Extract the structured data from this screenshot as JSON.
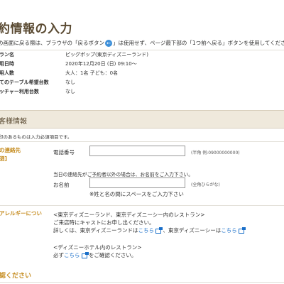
{
  "page": {
    "title": "約情報の入力",
    "back_note_before": "の画面に戻る際は、ブラウザの「戻るボタン",
    "back_icon": "←",
    "back_note_after": "」は使用せず、ページ最下部の「1つ前へ戻る」ボタンを使用してください。"
  },
  "summary": [
    {
      "label": "ラン名",
      "value": "ピッグポップ(東京ディズニーランド)"
    },
    {
      "label": "用日時",
      "value": "2020年12月20日 (日) 09:10～"
    },
    {
      "label": "用人数",
      "value": "大人：1名 子ども：0名"
    },
    {
      "label": "てのテーブル希望台数",
      "value": "なし"
    },
    {
      "label": "ッチャー利用台数",
      "value": "なし"
    }
  ],
  "section": {
    "header": "客様情報",
    "required_note": "印のあるものは入力必須項目です。"
  },
  "contact": {
    "left_label_line1": "の連絡先",
    "left_label_line2": "須]",
    "phone_label": "電話番号",
    "phone_value": "",
    "phone_hint": "(半角 例:09000000000)",
    "other_note": "当日の連絡先がご予約者以外の場合は、お名前をご入力下さい。",
    "name_label": "お名前",
    "name_value": "",
    "name_hint": "(全角ひらがな)",
    "name_space_note": "※姓と名の間にスペースをご入力下さい"
  },
  "allergy": {
    "left_label": "アレルギーについ",
    "line1": "<東京ディズニーランド、東京ディズニーシー内のレストラン>",
    "line2": "ご来店時にキャストにお申し出ください。",
    "line3_prefix": "詳しくは、東京ディズニーランドは",
    "link1": "こちら",
    "line3_middle": " 、東京ディズニーシーは",
    "link2": "こちら",
    "line4": "<ディズニーホテル内のレストラン>",
    "line5_prefix": "必ず",
    "link3": "こちら",
    "line5_suffix": " をご確認ください。"
  },
  "footer": {
    "bottom_header": "認ください"
  }
}
